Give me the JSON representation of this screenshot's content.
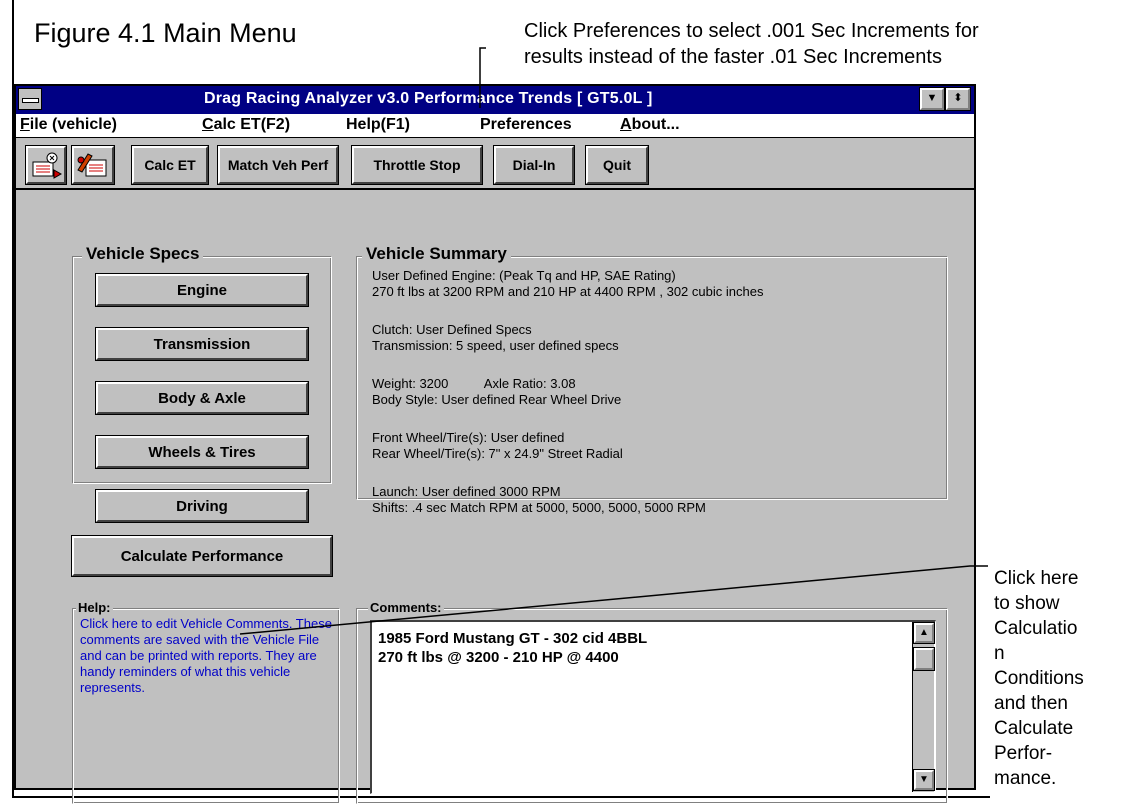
{
  "figure": {
    "caption": "Figure 4.1  Main Menu",
    "note_top_line1": "Click Preferences to select .001 Sec Increments for",
    "note_top_line2": "results instead of the faster .01 Sec Increments",
    "note_right_lines": [
      "Click here",
      "to show",
      "Calculatio",
      "n",
      "Conditions",
      "and then",
      "Calculate",
      "Perfor-",
      "mance."
    ]
  },
  "window": {
    "title": "Drag Racing Analyzer v3.0   Performance Trends   [ GT5.0L ]",
    "minimize_glyph": "▼",
    "restore_glyph": "⬍"
  },
  "menu": {
    "file": {
      "accel": "F",
      "rest": "ile (vehicle)"
    },
    "calc": {
      "accel": "C",
      "rest": "alc ET(F2)"
    },
    "help": {
      "label": "Help(F1)"
    },
    "preferences": {
      "label": "Preferences"
    },
    "about": {
      "accel": "A",
      "rest": "bout..."
    }
  },
  "toolbar": {
    "calc_et": "Calc ET",
    "match_veh_perf": "Match Veh Perf",
    "throttle_stop": "Throttle Stop",
    "dial_in": "Dial-In",
    "quit": "Quit"
  },
  "vehicle_specs": {
    "label": "Vehicle Specs",
    "engine": "Engine",
    "transmission": "Transmission",
    "body_axle": "Body & Axle",
    "wheels_tires": "Wheels & Tires",
    "driving": "Driving"
  },
  "vehicle_summary": {
    "label": "Vehicle Summary",
    "engine_line1": "User Defined Engine: (Peak Tq and HP, SAE Rating)",
    "engine_line2": "270 ft lbs at 3200 RPM  and  210 HP at 4400 RPM , 302 cubic inches",
    "clutch_line": "Clutch:  User Defined Specs",
    "transmission_line": "Transmission:   5 speed, user defined specs",
    "weight_line": "Weight: 3200          Axle Ratio: 3.08",
    "body_line": "Body Style:  User defined Rear Wheel Drive",
    "front_wheel_line": "Front Wheel/Tire(s):  User defined",
    "rear_wheel_line": "Rear Wheel/Tire(s):  7\" x 24.9\" Street Radial",
    "launch_line": "Launch:  User defined 3000 RPM",
    "shifts_line": "Shifts:  .4 sec Match RPM at  5000, 5000, 5000, 5000 RPM"
  },
  "calculate_button": "Calculate Performance",
  "help_panel": {
    "label": "Help:",
    "text": "Click here to edit Vehicle Comments.  These comments are saved with the Vehicle File and can be printed with reports.  They are handy reminders of what this vehicle represents."
  },
  "comments": {
    "label": "Comments:",
    "line1": "1985 Ford Mustang GT - 302 cid 4BBL",
    "line2": "270 ft lbs @ 3200 - 210 HP @ 4400",
    "scroll_up_glyph": "▲",
    "scroll_down_glyph": "▼"
  }
}
